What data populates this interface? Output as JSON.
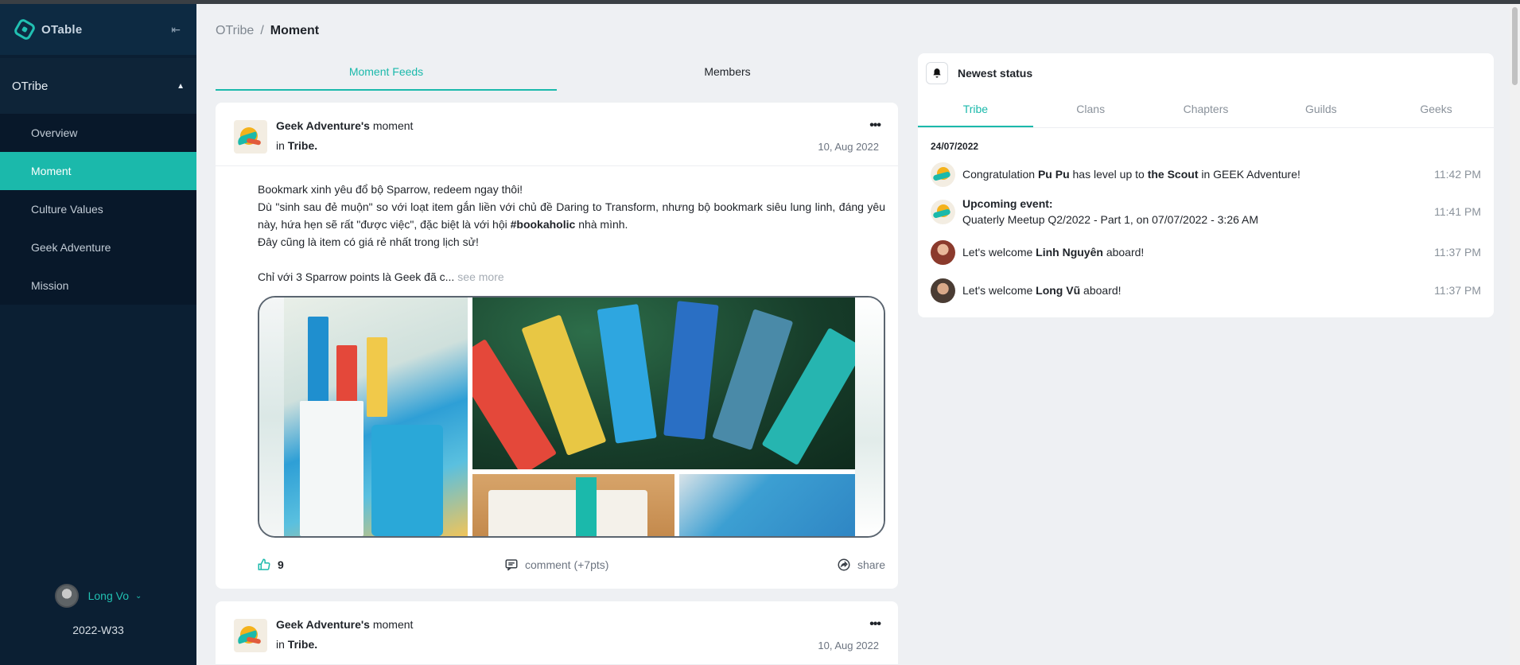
{
  "app": {
    "name": "OTable"
  },
  "sidebar": {
    "section": "OTribe",
    "items": [
      {
        "label": "Overview"
      },
      {
        "label": "Moment"
      },
      {
        "label": "Culture Values"
      },
      {
        "label": "Geek Adventure"
      },
      {
        "label": "Mission"
      }
    ],
    "active_index": 1,
    "user": {
      "name": "Long Vo",
      "week": "2022-W33"
    }
  },
  "breadcrumb": {
    "parent": "OTribe",
    "separator": "/",
    "current": "Moment"
  },
  "main": {
    "tabs": [
      {
        "label": "Moment Feeds"
      },
      {
        "label": "Members"
      }
    ],
    "active_tab": 0
  },
  "posts": [
    {
      "author": "Geek Adventure's",
      "author_suffix": "moment",
      "in_prefix": "in",
      "in_target": "Tribe.",
      "date": "10, Aug 2022",
      "lines": [
        "Bookmark xinh yêu đổ bộ Sparrow, redeem ngay thôi!",
        "Dù \"sinh sau đẻ muộn\" so với loạt item gắn liền với chủ đề Daring to Transform, nhưng bộ bookmark siêu lung linh, đáng yêu này, hứa hẹn sẽ rất \"được việc\", đặc biệt là với hội",
        "#bookaholic",
        "nhà mình.",
        "Đây cũng là item có giá rẻ nhất trong lịch sử!",
        "Chỉ với 3 Sparrow points là Geek đã c..."
      ],
      "see_more": "see more",
      "likes": "9",
      "comment_label": "comment (+7pts)",
      "share_label": "share"
    },
    {
      "author": "Geek Adventure's",
      "author_suffix": "moment",
      "in_prefix": "in",
      "in_target": "Tribe.",
      "date": "10, Aug 2022"
    }
  ],
  "status_panel": {
    "title": "Newest status",
    "tabs": [
      {
        "label": "Tribe"
      },
      {
        "label": "Clans"
      },
      {
        "label": "Chapters"
      },
      {
        "label": "Guilds"
      },
      {
        "label": "Geeks"
      }
    ],
    "active_tab": 0,
    "date": "24/07/2022",
    "items": [
      {
        "pre": "Congratulation",
        "b1": "Pu Pu",
        "mid": "has level up to",
        "b2": "the Scout",
        "post": "in GEEK Adventure!",
        "time": "11:42 PM"
      },
      {
        "title": "Upcoming event:",
        "text": "Quaterly Meetup Q2/2022 - Part 1, on 07/07/2022 - 3:26 AM",
        "time": "11:41 PM"
      },
      {
        "pre": "Let's welcome",
        "name": "Linh Nguyên",
        "post": "aboard!",
        "time": "11:37 PM"
      },
      {
        "pre": "Let's welcome",
        "name": "Long Vũ",
        "post": "aboard!",
        "time": "11:37 PM"
      }
    ]
  },
  "colors": {
    "accent": "#1bb9ab",
    "sidebar_bg": "#0b1f33",
    "page_bg": "#eef0f3"
  },
  "icons": {
    "logo": "hexagon-logo-icon",
    "collapse": "collapse-sidebar-icon",
    "bell": "bell-icon",
    "like": "thumbs-up-icon",
    "comment": "comment-icon",
    "share": "share-icon",
    "more": "more-dots-icon"
  }
}
